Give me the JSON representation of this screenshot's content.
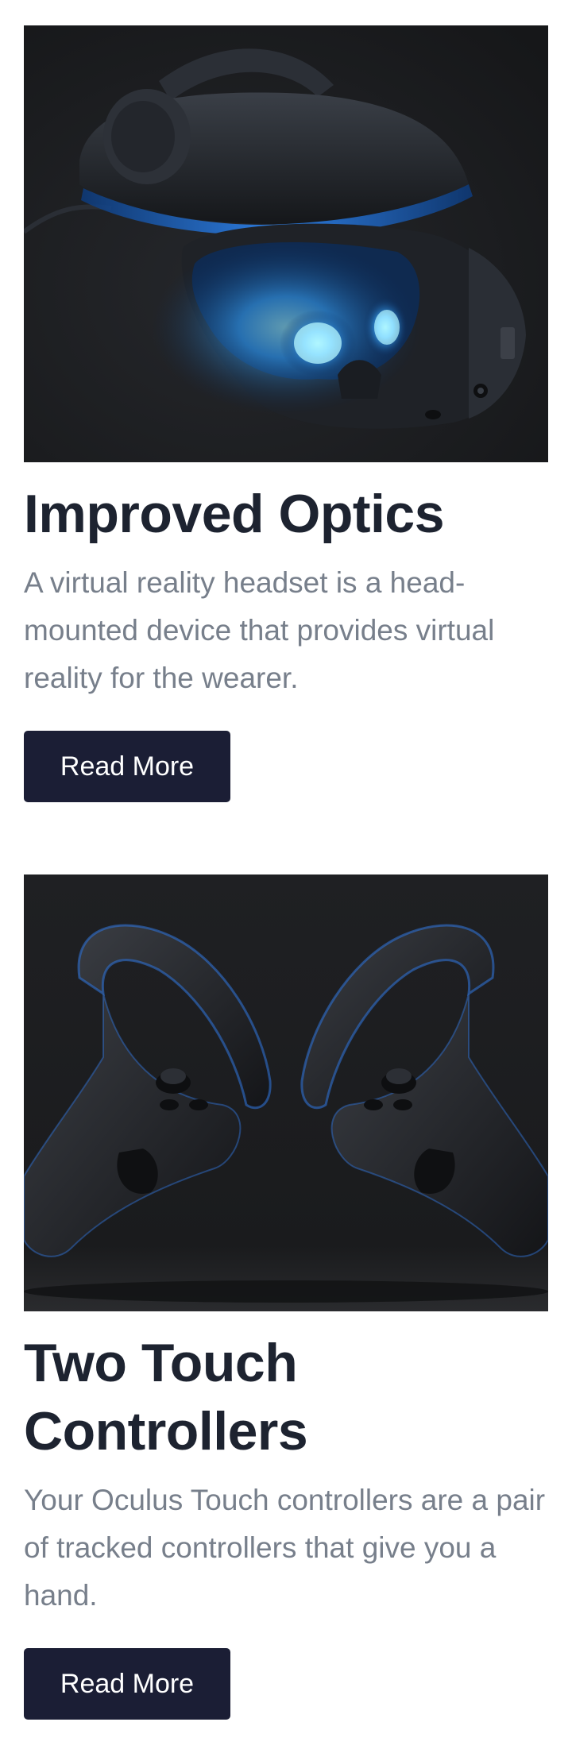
{
  "cards": [
    {
      "image_alt": "VR headset with glowing blue lenses",
      "title": "Improved Optics",
      "description": "A virtual reality headset is a head-mounted device that provides virtual reality for the wearer.",
      "button_label": "Read More"
    },
    {
      "image_alt": "Pair of Oculus Touch controllers",
      "title": "Two Touch Controllers",
      "description": "Your Oculus Touch controllers are a pair of tracked controllers that give you a hand.",
      "button_label": "Read More"
    }
  ],
  "colors": {
    "heading": "#1d2330",
    "body_text": "#777f8b",
    "button_bg": "#1b1e35",
    "button_text": "#ffffff",
    "image_bg": "#1c1c1e",
    "accent_glow": "#2f8cff"
  }
}
